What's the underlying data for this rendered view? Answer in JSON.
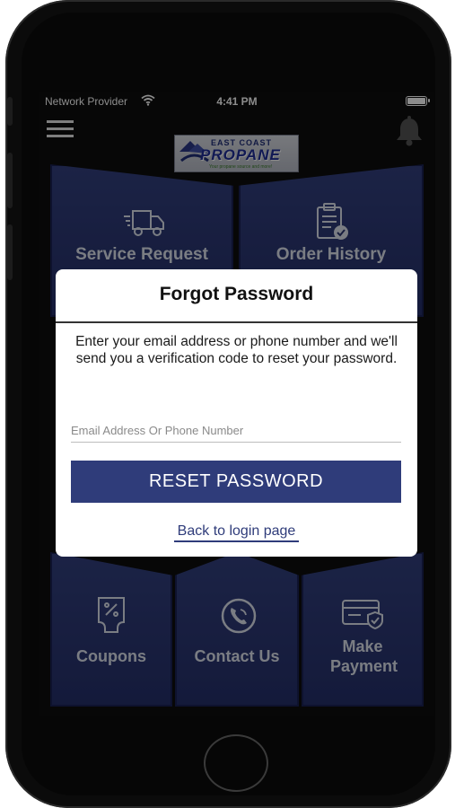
{
  "status_bar": {
    "carrier": "Network Provider",
    "time": "4:41 PM"
  },
  "header": {
    "menu_icon": "hamburger-icon",
    "bell_icon": "bell-icon",
    "logo": {
      "line1": "EAST COAST",
      "line2": "PROPANE",
      "tagline": "Your propane source and more!"
    }
  },
  "tiles": [
    {
      "label": "Service Request",
      "icon": "truck-icon"
    },
    {
      "label": "Order History",
      "icon": "clipboard-check-icon"
    },
    {
      "label": "Coupons",
      "icon": "coupon-icon"
    },
    {
      "label": "Contact Us",
      "icon": "phone-icon"
    },
    {
      "label": "Make Payment",
      "icon": "card-shield-icon"
    }
  ],
  "modal": {
    "title": "Forgot Password",
    "description": "Enter your email address or phone number and we'll send you a verification code to reset your password.",
    "input_placeholder": "Email Address Or Phone Number",
    "input_value": "",
    "reset_button": "RESET PASSWORD",
    "back_link": "Back to login page"
  },
  "colors": {
    "brand": "#2f3c7a",
    "tile": "#2b3672"
  }
}
